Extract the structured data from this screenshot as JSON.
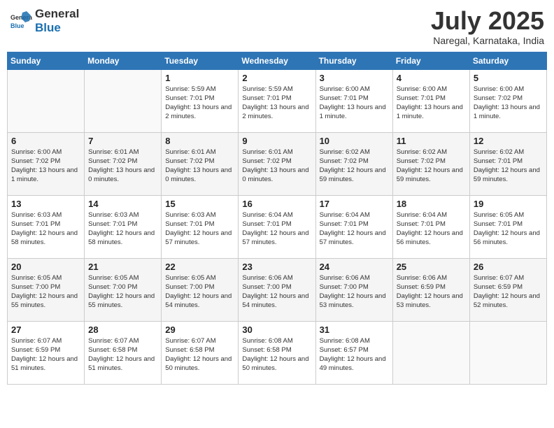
{
  "header": {
    "logo_general": "General",
    "logo_blue": "Blue",
    "month": "July 2025",
    "location": "Naregal, Karnataka, India"
  },
  "days_of_week": [
    "Sunday",
    "Monday",
    "Tuesday",
    "Wednesday",
    "Thursday",
    "Friday",
    "Saturday"
  ],
  "weeks": [
    [
      {
        "day": "",
        "info": ""
      },
      {
        "day": "",
        "info": ""
      },
      {
        "day": "1",
        "info": "Sunrise: 5:59 AM\nSunset: 7:01 PM\nDaylight: 13 hours and 2 minutes."
      },
      {
        "day": "2",
        "info": "Sunrise: 5:59 AM\nSunset: 7:01 PM\nDaylight: 13 hours and 2 minutes."
      },
      {
        "day": "3",
        "info": "Sunrise: 6:00 AM\nSunset: 7:01 PM\nDaylight: 13 hours and 1 minute."
      },
      {
        "day": "4",
        "info": "Sunrise: 6:00 AM\nSunset: 7:01 PM\nDaylight: 13 hours and 1 minute."
      },
      {
        "day": "5",
        "info": "Sunrise: 6:00 AM\nSunset: 7:02 PM\nDaylight: 13 hours and 1 minute."
      }
    ],
    [
      {
        "day": "6",
        "info": "Sunrise: 6:00 AM\nSunset: 7:02 PM\nDaylight: 13 hours and 1 minute."
      },
      {
        "day": "7",
        "info": "Sunrise: 6:01 AM\nSunset: 7:02 PM\nDaylight: 13 hours and 0 minutes."
      },
      {
        "day": "8",
        "info": "Sunrise: 6:01 AM\nSunset: 7:02 PM\nDaylight: 13 hours and 0 minutes."
      },
      {
        "day": "9",
        "info": "Sunrise: 6:01 AM\nSunset: 7:02 PM\nDaylight: 13 hours and 0 minutes."
      },
      {
        "day": "10",
        "info": "Sunrise: 6:02 AM\nSunset: 7:02 PM\nDaylight: 12 hours and 59 minutes."
      },
      {
        "day": "11",
        "info": "Sunrise: 6:02 AM\nSunset: 7:02 PM\nDaylight: 12 hours and 59 minutes."
      },
      {
        "day": "12",
        "info": "Sunrise: 6:02 AM\nSunset: 7:01 PM\nDaylight: 12 hours and 59 minutes."
      }
    ],
    [
      {
        "day": "13",
        "info": "Sunrise: 6:03 AM\nSunset: 7:01 PM\nDaylight: 12 hours and 58 minutes."
      },
      {
        "day": "14",
        "info": "Sunrise: 6:03 AM\nSunset: 7:01 PM\nDaylight: 12 hours and 58 minutes."
      },
      {
        "day": "15",
        "info": "Sunrise: 6:03 AM\nSunset: 7:01 PM\nDaylight: 12 hours and 57 minutes."
      },
      {
        "day": "16",
        "info": "Sunrise: 6:04 AM\nSunset: 7:01 PM\nDaylight: 12 hours and 57 minutes."
      },
      {
        "day": "17",
        "info": "Sunrise: 6:04 AM\nSunset: 7:01 PM\nDaylight: 12 hours and 57 minutes."
      },
      {
        "day": "18",
        "info": "Sunrise: 6:04 AM\nSunset: 7:01 PM\nDaylight: 12 hours and 56 minutes."
      },
      {
        "day": "19",
        "info": "Sunrise: 6:05 AM\nSunset: 7:01 PM\nDaylight: 12 hours and 56 minutes."
      }
    ],
    [
      {
        "day": "20",
        "info": "Sunrise: 6:05 AM\nSunset: 7:00 PM\nDaylight: 12 hours and 55 minutes."
      },
      {
        "day": "21",
        "info": "Sunrise: 6:05 AM\nSunset: 7:00 PM\nDaylight: 12 hours and 55 minutes."
      },
      {
        "day": "22",
        "info": "Sunrise: 6:05 AM\nSunset: 7:00 PM\nDaylight: 12 hours and 54 minutes."
      },
      {
        "day": "23",
        "info": "Sunrise: 6:06 AM\nSunset: 7:00 PM\nDaylight: 12 hours and 54 minutes."
      },
      {
        "day": "24",
        "info": "Sunrise: 6:06 AM\nSunset: 7:00 PM\nDaylight: 12 hours and 53 minutes."
      },
      {
        "day": "25",
        "info": "Sunrise: 6:06 AM\nSunset: 6:59 PM\nDaylight: 12 hours and 53 minutes."
      },
      {
        "day": "26",
        "info": "Sunrise: 6:07 AM\nSunset: 6:59 PM\nDaylight: 12 hours and 52 minutes."
      }
    ],
    [
      {
        "day": "27",
        "info": "Sunrise: 6:07 AM\nSunset: 6:59 PM\nDaylight: 12 hours and 51 minutes."
      },
      {
        "day": "28",
        "info": "Sunrise: 6:07 AM\nSunset: 6:58 PM\nDaylight: 12 hours and 51 minutes."
      },
      {
        "day": "29",
        "info": "Sunrise: 6:07 AM\nSunset: 6:58 PM\nDaylight: 12 hours and 50 minutes."
      },
      {
        "day": "30",
        "info": "Sunrise: 6:08 AM\nSunset: 6:58 PM\nDaylight: 12 hours and 50 minutes."
      },
      {
        "day": "31",
        "info": "Sunrise: 6:08 AM\nSunset: 6:57 PM\nDaylight: 12 hours and 49 minutes."
      },
      {
        "day": "",
        "info": ""
      },
      {
        "day": "",
        "info": ""
      }
    ]
  ]
}
